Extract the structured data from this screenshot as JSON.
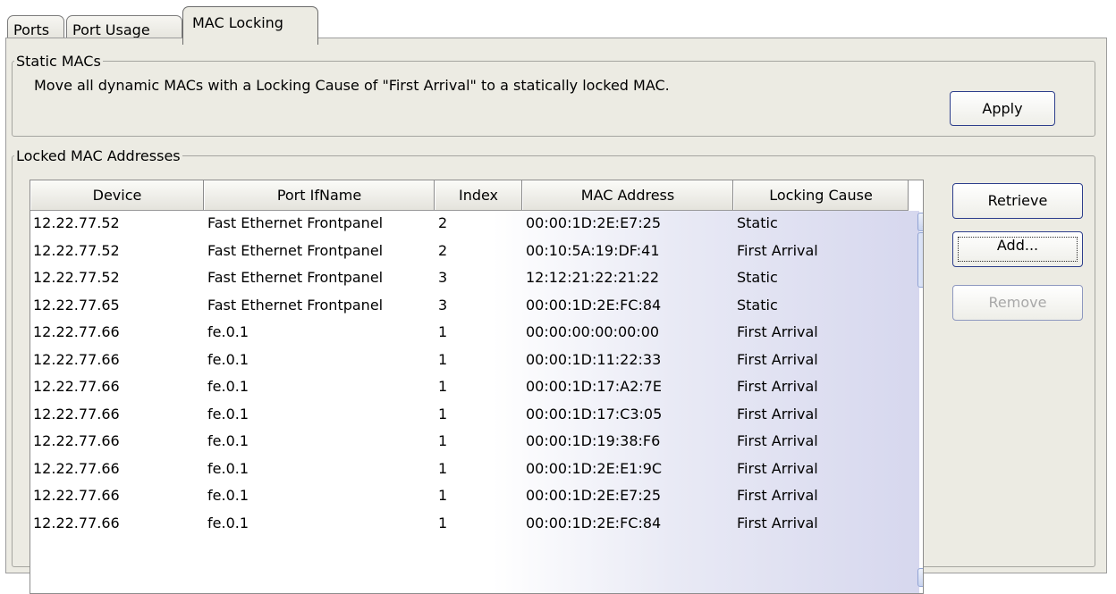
{
  "tabs": [
    {
      "label": "Ports",
      "active": false
    },
    {
      "label": "Port Usage",
      "active": false
    },
    {
      "label": "MAC Locking",
      "active": true
    }
  ],
  "static_macs": {
    "legend": "Static MACs",
    "description": "Move all dynamic MACs with a Locking Cause of \"First Arrival\" to a statically locked MAC.",
    "apply_label": "Apply"
  },
  "locked": {
    "legend": "Locked MAC Addresses",
    "columns": [
      "Device",
      "Port IfName",
      "Index",
      "MAC Address",
      "Locking Cause"
    ],
    "rows": [
      [
        "12.22.77.52",
        "Fast Ethernet Frontpanel",
        "2",
        "00:00:1D:2E:E7:25",
        "Static"
      ],
      [
        "12.22.77.52",
        "Fast Ethernet Frontpanel",
        "2",
        "00:10:5A:19:DF:41",
        "First Arrival"
      ],
      [
        "12.22.77.52",
        "Fast Ethernet Frontpanel",
        "3",
        "12:12:21:22:21:22",
        "Static"
      ],
      [
        "12.22.77.65",
        "Fast Ethernet Frontpanel",
        "3",
        "00:00:1D:2E:FC:84",
        "Static"
      ],
      [
        "12.22.77.66",
        "fe.0.1",
        "1",
        "00:00:00:00:00:00",
        "First Arrival"
      ],
      [
        "12.22.77.66",
        "fe.0.1",
        "1",
        "00:00:1D:11:22:33",
        "First Arrival"
      ],
      [
        "12.22.77.66",
        "fe.0.1",
        "1",
        "00:00:1D:17:A2:7E",
        "First Arrival"
      ],
      [
        "12.22.77.66",
        "fe.0.1",
        "1",
        "00:00:1D:17:C3:05",
        "First Arrival"
      ],
      [
        "12.22.77.66",
        "fe.0.1",
        "1",
        "00:00:1D:19:38:F6",
        "First Arrival"
      ],
      [
        "12.22.77.66",
        "fe.0.1",
        "1",
        "00:00:1D:2E:E1:9C",
        "First Arrival"
      ],
      [
        "12.22.77.66",
        "fe.0.1",
        "1",
        "00:00:1D:2E:E7:25",
        "First Arrival"
      ],
      [
        "12.22.77.66",
        "fe.0.1",
        "1",
        "00:00:1D:2E:FC:84",
        "First Arrival"
      ]
    ],
    "buttons": {
      "retrieve": "Retrieve",
      "add": "Add...",
      "remove": "Remove"
    }
  },
  "scrollbar": {
    "up_icon": "chevron-up-icon",
    "down_icon": "chevron-down-icon"
  }
}
